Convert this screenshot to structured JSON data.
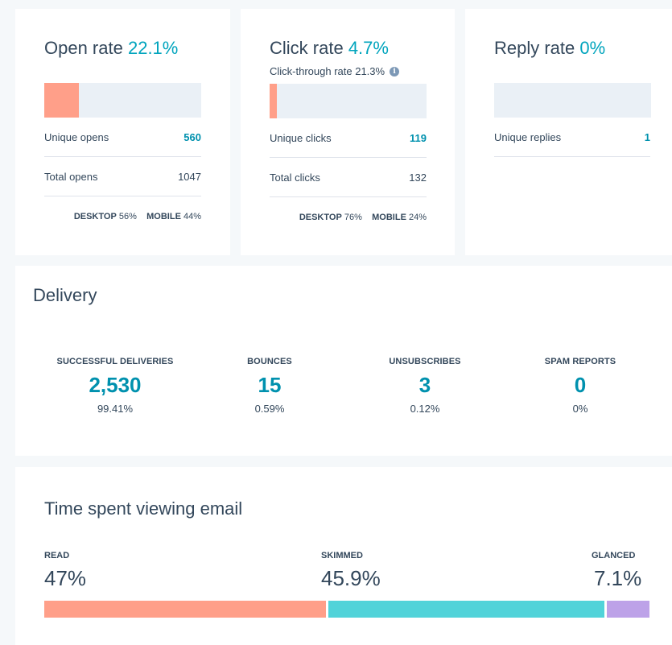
{
  "open_rate": {
    "title": "Open rate",
    "value": "22.1%",
    "fill_fraction": 0.221,
    "unique_label": "Unique opens",
    "unique_value": "560",
    "total_label": "Total opens",
    "total_value": "1047",
    "desktop_label": "DESKTOP",
    "desktop_value": "56%",
    "mobile_label": "MOBILE",
    "mobile_value": "44%"
  },
  "click_rate": {
    "title": "Click rate",
    "value": "4.7%",
    "fill_fraction": 0.047,
    "sub_label": "Click-through rate 21.3%",
    "unique_label": "Unique clicks",
    "unique_value": "119",
    "total_label": "Total clicks",
    "total_value": "132",
    "desktop_label": "DESKTOP",
    "desktop_value": "76%",
    "mobile_label": "MOBILE",
    "mobile_value": "24%"
  },
  "reply_rate": {
    "title": "Reply rate",
    "value": "0%",
    "fill_fraction": 0,
    "unique_label": "Unique replies",
    "unique_value": "1"
  },
  "delivery": {
    "title": "Delivery",
    "metrics": [
      {
        "label": "SUCCESSFUL DELIVERIES",
        "value": "2,530",
        "percent": "99.41%"
      },
      {
        "label": "BOUNCES",
        "value": "15",
        "percent": "0.59%"
      },
      {
        "label": "UNSUBSCRIBES",
        "value": "3",
        "percent": "0.12%"
      },
      {
        "label": "SPAM REPORTS",
        "value": "0",
        "percent": "0%"
      }
    ]
  },
  "time_viewing": {
    "title": "Time spent viewing email",
    "segments": [
      {
        "label": "READ",
        "percent": "47%",
        "fraction": 0.47,
        "color": "#ff9f89"
      },
      {
        "label": "SKIMMED",
        "percent": "45.9%",
        "fraction": 0.459,
        "color": "#51d3d9"
      },
      {
        "label": "GLANCED",
        "percent": "7.1%",
        "fraction": 0.071,
        "color": "#bda2e8"
      }
    ]
  },
  "colors": {
    "accent": "#0091ae",
    "accent_light": "#00a4bd",
    "bar_track": "#eaf0f6",
    "bar_fill": "#ff9f89",
    "text": "#33475b"
  },
  "icons": {
    "info": "info-icon"
  }
}
